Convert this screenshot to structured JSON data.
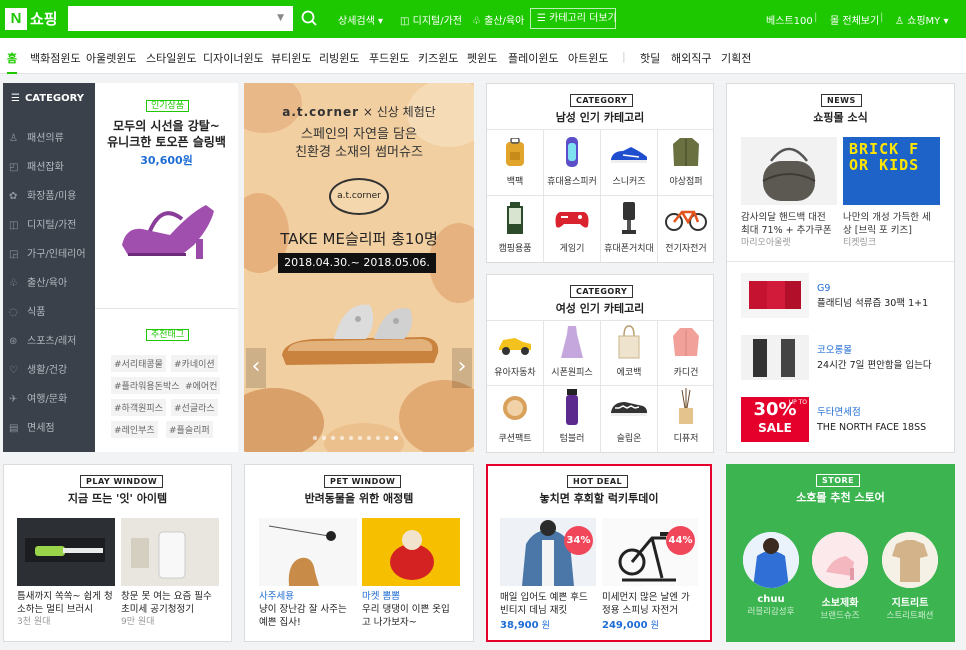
{
  "topbar": {
    "logo": "N",
    "title": "쇼핑",
    "search_placeholder": "",
    "search_button_icon": "search-icon",
    "detail_search": "상세검색",
    "digital": "디지털/가전",
    "baby": "출산/육아",
    "category_more": "카테고리 더보기",
    "best100": "베스트100",
    "all_mall": "몰 전체보기",
    "my": "쇼핑MY"
  },
  "subnav": [
    "홈",
    "백화점윈도",
    "아울렛윈도",
    "스타일윈도",
    "디자이너윈도",
    "뷰티윈도",
    "리빙윈도",
    "푸드윈도",
    "키즈윈도",
    "펫윈도",
    "플레이윈도",
    "아트윈도",
    "핫딜",
    "해외직구",
    "기획전"
  ],
  "sidebar": {
    "head": "CATEGORY",
    "items": [
      {
        "icon": "shirt-icon",
        "label": "패션의류"
      },
      {
        "icon": "bag-icon",
        "label": "패션잡화"
      },
      {
        "icon": "cosmetics-icon",
        "label": "화장품/미용"
      },
      {
        "icon": "camera-icon",
        "label": "디지털/가전"
      },
      {
        "icon": "sofa-icon",
        "label": "가구/인테리어"
      },
      {
        "icon": "stroller-icon",
        "label": "출산/육아"
      },
      {
        "icon": "apple-icon",
        "label": "식품"
      },
      {
        "icon": "bike-icon",
        "label": "스포츠/레저"
      },
      {
        "icon": "health-icon",
        "label": "생활/건강"
      },
      {
        "icon": "plane-icon",
        "label": "여행/문화"
      },
      {
        "icon": "ticket-icon",
        "label": "면세점"
      }
    ]
  },
  "popular": {
    "tag": "인기상품",
    "title1": "모두의 시선을 강탈~",
    "title2": "유니크한 토오픈 슬링백",
    "price": "30,600원",
    "rec_tag": "추천태그",
    "hashtags": [
      "#서리태콩물",
      "#카네이션",
      "#플라워용돈박스",
      "#에어컨",
      "#하객원피스",
      "#선글라스",
      "#레인부츠",
      "#플슬리퍼"
    ]
  },
  "banner": {
    "brand": "a.t.corner",
    "x": "×",
    "partner": "신상 체험단",
    "line1": "스페인의 자연을 담은",
    "line2": "친환경 소재의 썸머슈즈",
    "seal": "a.t.corner",
    "promo": "TAKE ME슬리퍼 총10명",
    "dates": "2018.04.30.~ 2018.05.06.",
    "left_arrow": "‹",
    "right_arrow": "›"
  },
  "men": {
    "label": "CATEGORY",
    "title": "남성 인기 카테고리",
    "items": [
      {
        "icon": "backpack-icon",
        "label": "백팩"
      },
      {
        "icon": "speaker-icon",
        "label": "휴대용스피커"
      },
      {
        "icon": "sneakers-icon",
        "label": "스니커즈"
      },
      {
        "icon": "field-jacket-icon",
        "label": "야상점퍼"
      },
      {
        "icon": "lantern-icon",
        "label": "캠핑용품"
      },
      {
        "icon": "gamepad-icon",
        "label": "게임기"
      },
      {
        "icon": "phone-holder-icon",
        "label": "휴대폰거치대"
      },
      {
        "icon": "bicycle-icon",
        "label": "전기자전거"
      }
    ]
  },
  "women": {
    "label": "CATEGORY",
    "title": "여성 인기 카테고리",
    "items": [
      {
        "icon": "toy-car-icon",
        "label": "유아자동차"
      },
      {
        "icon": "dress-icon",
        "label": "시폰원피스"
      },
      {
        "icon": "ecobag-icon",
        "label": "에코백"
      },
      {
        "icon": "cardigan-icon",
        "label": "카디건"
      },
      {
        "icon": "compact-icon",
        "label": "쿠션팩트"
      },
      {
        "icon": "tumbler-icon",
        "label": "텀블러"
      },
      {
        "icon": "slip-on-icon",
        "label": "슬립온"
      },
      {
        "icon": "diffuser-icon",
        "label": "디퓨저"
      }
    ]
  },
  "news": {
    "label": "NEWS",
    "title": "쇼핑몰 소식",
    "card1": {
      "text1": "감사의달 핸드백 대전",
      "text2": "최대 71% + 추가쿠폰",
      "source": "마리오아울렛"
    },
    "card2": {
      "text1": "나만의 개성 가득한 세",
      "text2": "상 [브릭 포 키즈]",
      "source": "티켓링크",
      "art": "BRICK FOR KIDS"
    },
    "rows": [
      {
        "brand": "G9",
        "text": "플래티넘 석류즙 30팩 1+1"
      },
      {
        "brand": "코오롱몰",
        "text": "24시간 7일 편안함을 입는다"
      },
      {
        "brand": "두타면세점",
        "text": "THE NORTH FACE 18SS",
        "sale": "30%",
        "saleword": "SALE",
        "upto": "UP TO"
      }
    ]
  },
  "play": {
    "label": "PLAY WINDOW",
    "title": "지금 뜨는 '잇' 아이템",
    "items": [
      {
        "d1": "틈새까지 쏙쏙~ 쉽게 청",
        "d2": "소하는 멀티 브러시",
        "meta": "3천 원대"
      },
      {
        "d1": "창문 못 여는 요즘 필수",
        "d2": "초미세 공기청정기",
        "meta": "9만 원대"
      }
    ]
  },
  "pet": {
    "label": "PET WINDOW",
    "title": "반려동물을 위한 애정템",
    "items": [
      {
        "brand": "사주세용",
        "d1": "냥이 장난감 잘 사주는",
        "d2": "예쁜 집사!"
      },
      {
        "brand": "마켓 뽐뽐",
        "d1": "우리 댕댕이 이쁜 옷입",
        "d2": "고 나가보자~"
      }
    ]
  },
  "hotdeal": {
    "label": "HOT DEAL",
    "title": "놓치면 후회할 럭키투데이",
    "items": [
      {
        "pct": "34%",
        "d1": "매일 입어도 예쁜 후드",
        "d2": "빈티지 데님 재킷",
        "price": "38,900",
        "won": "원"
      },
      {
        "pct": "44%",
        "d1": "미세먼지 많은 날엔 가",
        "d2": "정용 스피닝 자전거",
        "price": "249,000",
        "won": "원"
      }
    ]
  },
  "store": {
    "label": "STORE",
    "title": "소호몰 추천 스토어",
    "items": [
      {
        "name": "chuu",
        "sub": "러블리감성후"
      },
      {
        "name": "소보제화",
        "sub": "브랜드슈즈"
      },
      {
        "name": "지트리트",
        "sub": "스트리트패션"
      }
    ]
  },
  "colors": {
    "green": "#1ec800",
    "sidebar": "#3a414a",
    "red": "#e4002b",
    "blue": "#1f6dd4"
  }
}
